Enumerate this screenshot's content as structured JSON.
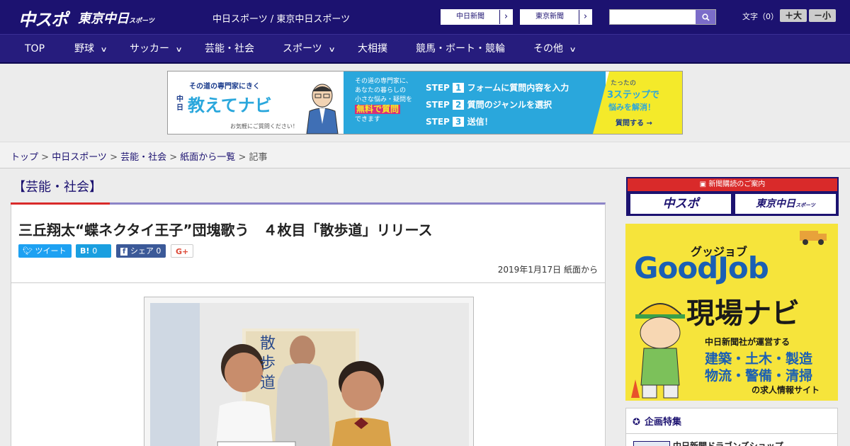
{
  "header": {
    "logo_main": "中スポ",
    "logo_sub": "東京中日",
    "logo_sub_small": "スポーツ",
    "site_name": "中日スポーツ / 東京中日スポーツ",
    "ext_link_1": "中日新聞",
    "ext_link_2": "東京新聞",
    "search": {
      "placeholder": "",
      "value": ""
    },
    "font_size_label": "文字（0）",
    "font_bigger": "＋大",
    "font_smaller": "－小"
  },
  "nav": {
    "items": [
      {
        "label": "TOP"
      },
      {
        "label": "野球"
      },
      {
        "label": "サッカー"
      },
      {
        "label": "芸能・社会"
      },
      {
        "label": "スポーツ"
      },
      {
        "label": "大相撲"
      },
      {
        "label": "競馬・ボート・競輪"
      },
      {
        "label": "その他"
      }
    ]
  },
  "banner": {
    "tagline": "その道の専門家にきく",
    "brand": "教えてナビ",
    "brand_prefix": "中日",
    "note": "お気軽にご質問ください！",
    "desc_1": "その道の専門家に、",
    "desc_2": "あなたの暮らしの",
    "desc_3": "小さな悩み・疑問を",
    "desc_4": "無料で質問",
    "desc_5": "できます",
    "step1": "フォームに質問内容を入力",
    "step2": "質問のジャンルを選択",
    "step3": "送信！",
    "step_word": "STEP",
    "right_1": "たったの",
    "right_2": "3ステップで",
    "right_3": "悩みを解消！",
    "right_btn": "質問する"
  },
  "breadcrumb": {
    "items": [
      "トップ",
      "中日スポーツ",
      "芸能・社会",
      "紙面から一覧"
    ],
    "current": "記事",
    "sep": " > "
  },
  "article": {
    "section": "【芸能・社会】",
    "headline": "三丘翔太“蝶ネクタイ王子”団塊歌う　４枚目「散歩道」リリース",
    "share_tweet": "ツイート",
    "share_hatena": "B!",
    "share_hatena_count": "0",
    "share_fb": "シェア",
    "share_fb_count": "0",
    "share_gplus": "G+",
    "date": "2019年1月17日 紙面から",
    "photo_poster_text": "散歩道"
  },
  "sidebar": {
    "subscribe_title": "新聞購読のご案内",
    "subscribe_btn_1": "中スポ",
    "subscribe_btn_2": "東京中日",
    "subscribe_btn_2_small": "スポーツ",
    "goodjob_kana": "グッジョブ",
    "goodjob_title": "GoodJob",
    "goodjob_sub": "現場ナビ",
    "goodjob_line1": "中日新聞社が運営する",
    "goodjob_line2": "建築・土木・製造",
    "goodjob_line3": "物流・警備・清掃",
    "goodjob_line4": "の求人情報サイト",
    "feature_title": "企画特集",
    "feature_item": "中日新聞ドラゴンズショップ"
  },
  "colors": {
    "header_bg": "#1c1270",
    "nav_bg": "#261c7d",
    "accent_red": "#d92a2a",
    "banner_blue": "#2aa7dc",
    "banner_yellow": "#f4ea2a",
    "goodjob_yellow": "#f6e43b",
    "goodjob_blue": "#1a5fb4"
  }
}
